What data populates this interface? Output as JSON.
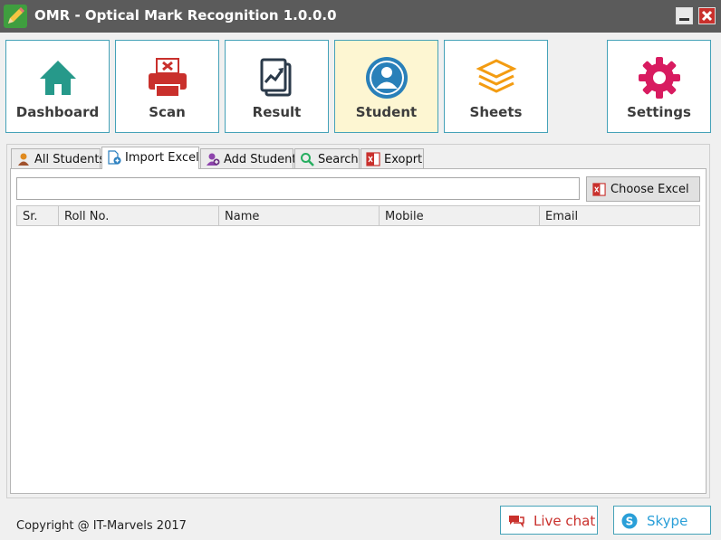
{
  "window": {
    "title": "OMR - Optical Mark Recognition 1.0.0.0",
    "app_icon": "pencil-icon",
    "controls": [
      "minimize-icon",
      "close-icon"
    ]
  },
  "nav": [
    {
      "label": "Dashboard",
      "icon": "home-icon",
      "color": "#26998a",
      "active": false
    },
    {
      "label": "Scan",
      "icon": "printer-icon",
      "color": "#c9302c",
      "active": false
    },
    {
      "label": "Result",
      "icon": "chart-document-icon",
      "color": "#2b3a4a",
      "active": false
    },
    {
      "label": "Student",
      "icon": "user-icon",
      "color": "#2980b9",
      "active": true
    },
    {
      "label": "Sheets",
      "icon": "layers-icon",
      "color": "#f39c12",
      "active": false
    },
    {
      "label": "Settings",
      "icon": "gear-icon",
      "color": "#d81b60",
      "active": false
    }
  ],
  "tabs": [
    {
      "label": "All Students",
      "icon": "user-icon",
      "active": false
    },
    {
      "label": "Import Excel",
      "icon": "document-add-icon",
      "active": true
    },
    {
      "label": "Add Student",
      "icon": "add-user-icon",
      "active": false
    },
    {
      "label": "Search",
      "icon": "search-icon",
      "active": false
    },
    {
      "label": "Exoprt",
      "icon": "excel-icon",
      "active": false
    }
  ],
  "import": {
    "file_path": "",
    "choose_button": "Choose Excel"
  },
  "grid": {
    "columns": [
      "Sr.",
      "Roll No.",
      "Name",
      "Mobile",
      "Email"
    ],
    "rows": []
  },
  "footer": {
    "copyright": "Copyright @ IT-Marvels 2017",
    "live_chat": "Live chat",
    "skype": "Skype"
  },
  "colors": {
    "titlebar": "#5b5b5b",
    "tile_border": "#45a2b8",
    "active_tile": "#fdf6d2",
    "live_chat": "#c9302c",
    "skype": "#2a9fd8"
  }
}
